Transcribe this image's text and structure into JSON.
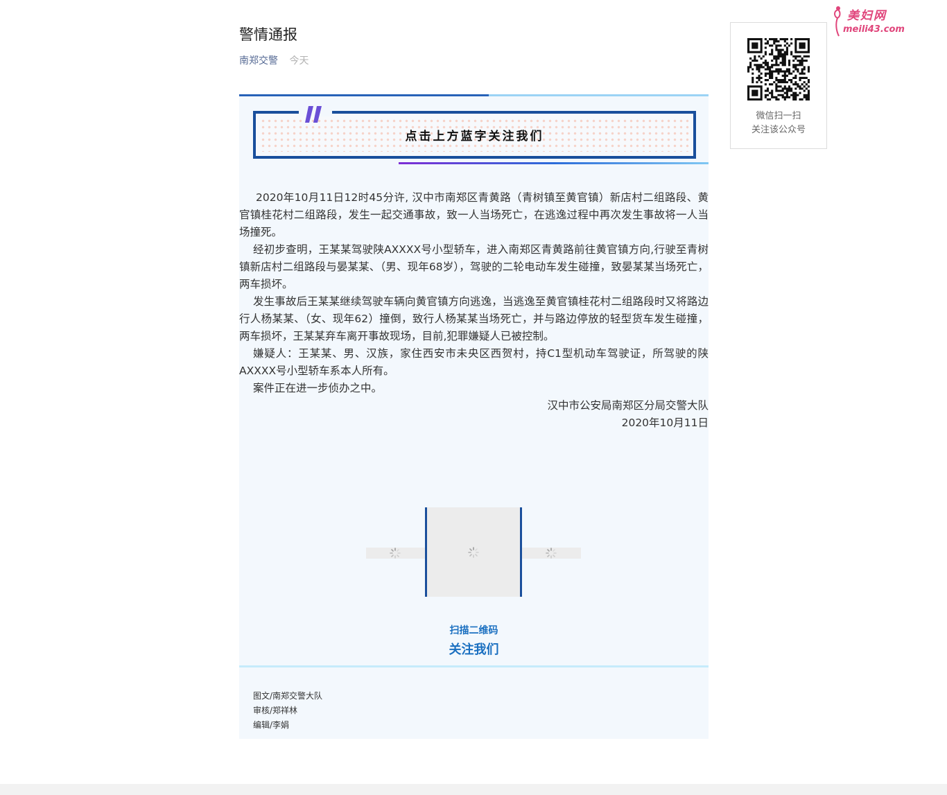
{
  "article": {
    "title": "警情通报",
    "account_name": "南郑交警",
    "publish_date": "今天"
  },
  "banner": {
    "follow_text": "点击上方蓝字关注我们"
  },
  "body": {
    "paragraphs": [
      "2020年10月11日12时45分许, 汉中市南郑区青黄路（青树镇至黄官镇）新店村二组路段、黄官镇桂花村二组路段，发生一起交通事故，致一人当场死亡，在逃逸过程中再次发生事故将一人当场撞死。",
      "经初步查明，王某某驾驶陕AXXXX号小型轿车，进入南郑区青黄路前往黄官镇方向,行驶至青树镇新店村二组路段与晏某某、（男、现年68岁），驾驶的二轮电动车发生碰撞，致晏某某当场死亡，两车损坏。",
      "发生事故后王某某继续驾驶车辆向黄官镇方向逃逸，当逃逸至黄官镇桂花村二组路段时又将路边行人杨某某、（女、现年62）撞倒，致行人杨某某当场死亡，并与路边停放的轻型货车发生碰撞，两车损坏，王某某弃车离开事故现场，目前,犯罪嫌疑人已被控制。",
      "嫌疑人：王某某、男、汉族，家住西安市未央区西贺村，持C1型机动车驾驶证，所驾驶的陕AXXXX号小型轿车系本人所有。",
      "案件正在进一步侦办之中。"
    ],
    "signature_org": "汉中市公安局南郑区分局交警大队",
    "signature_date": "2020年10月11日"
  },
  "qr_section": {
    "scan_label": "扫描二维码",
    "follow_label": "关注我们"
  },
  "credits": {
    "line1": "图文/南郑交警大队",
    "line2": "审核/郑祥林",
    "line3": "编辑/李娟"
  },
  "sidebar_qr": {
    "line1": "微信扫一扫",
    "line2": "关注该公众号"
  },
  "watermark": {
    "name": "美妇网",
    "domain": "meili43.com"
  },
  "icons": {
    "quote": "double-quote-icon",
    "loading": "loading-spinner-icon",
    "qr": "qr-code-icon"
  },
  "colors": {
    "account_link": "#576b95",
    "accent_blue": "#1a4f9c",
    "label_blue": "#1a6fc0",
    "watermark_pink": "#e0457b"
  }
}
